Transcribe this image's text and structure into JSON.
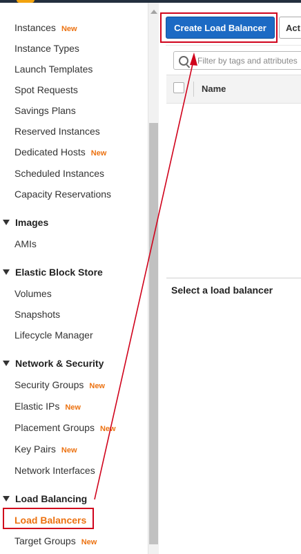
{
  "sidebar": {
    "items": [
      {
        "label": "Instances",
        "badge": "New"
      },
      {
        "label": "Instance Types"
      },
      {
        "label": "Launch Templates"
      },
      {
        "label": "Spot Requests"
      },
      {
        "label": "Savings Plans"
      },
      {
        "label": "Reserved Instances"
      },
      {
        "label": "Dedicated Hosts",
        "badge": "New"
      },
      {
        "label": "Scheduled Instances"
      },
      {
        "label": "Capacity Reservations"
      }
    ],
    "sections": {
      "images": {
        "title": "Images",
        "items": [
          {
            "label": "AMIs"
          }
        ]
      },
      "ebs": {
        "title": "Elastic Block Store",
        "items": [
          {
            "label": "Volumes"
          },
          {
            "label": "Snapshots"
          },
          {
            "label": "Lifecycle Manager"
          }
        ]
      },
      "network": {
        "title": "Network & Security",
        "items": [
          {
            "label": "Security Groups",
            "badge": "New"
          },
          {
            "label": "Elastic IPs",
            "badge": "New"
          },
          {
            "label": "Placement Groups",
            "badge": "New"
          },
          {
            "label": "Key Pairs",
            "badge": "New"
          },
          {
            "label": "Network Interfaces"
          }
        ]
      },
      "lb": {
        "title": "Load Balancing",
        "items": [
          {
            "label": "Load Balancers",
            "active": true
          },
          {
            "label": "Target Groups",
            "badge": "New"
          }
        ]
      }
    }
  },
  "toolbar": {
    "create_label": "Create Load Balancer",
    "actions_label": "Act"
  },
  "filter": {
    "placeholder": "Filter by tags and attributes"
  },
  "table": {
    "columns": [
      "Name"
    ]
  },
  "detail": {
    "title": "Select a load balancer"
  },
  "colors": {
    "accent": "#ec7211",
    "primary_button": "#1c6ac4",
    "highlight": "#d0021b"
  }
}
